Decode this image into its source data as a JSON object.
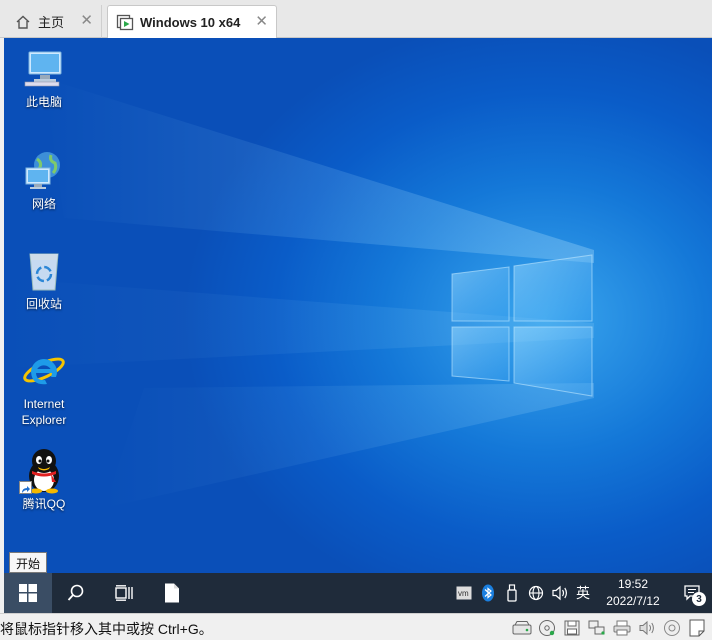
{
  "tabs": [
    {
      "label": "主页",
      "icon": "home-icon"
    },
    {
      "label": "Windows 10 x64",
      "icon": "vm-running-icon"
    }
  ],
  "desktop_icons": [
    {
      "label": "此电脑",
      "icon": "this-pc-icon"
    },
    {
      "label": "网络",
      "icon": "network-icon"
    },
    {
      "label": "回收站",
      "icon": "recycle-bin-icon"
    },
    {
      "label": "Internet\nExplorer",
      "icon": "internet-explorer-icon"
    },
    {
      "label": "腾讯QQ",
      "icon": "qq-icon"
    }
  ],
  "tooltip": "开始",
  "taskbar": {
    "tray_ime": "英",
    "clock_time": "19:52",
    "clock_date": "2022/7/12",
    "notification_count": "3"
  },
  "statusbar": {
    "message": "将鼠标指针移入其中或按 Ctrl+G。"
  },
  "colors": {
    "desktop_blue": "#0a5cc8",
    "taskbar": "#1f2b3a",
    "vm_play_green": "#2aa84a"
  }
}
